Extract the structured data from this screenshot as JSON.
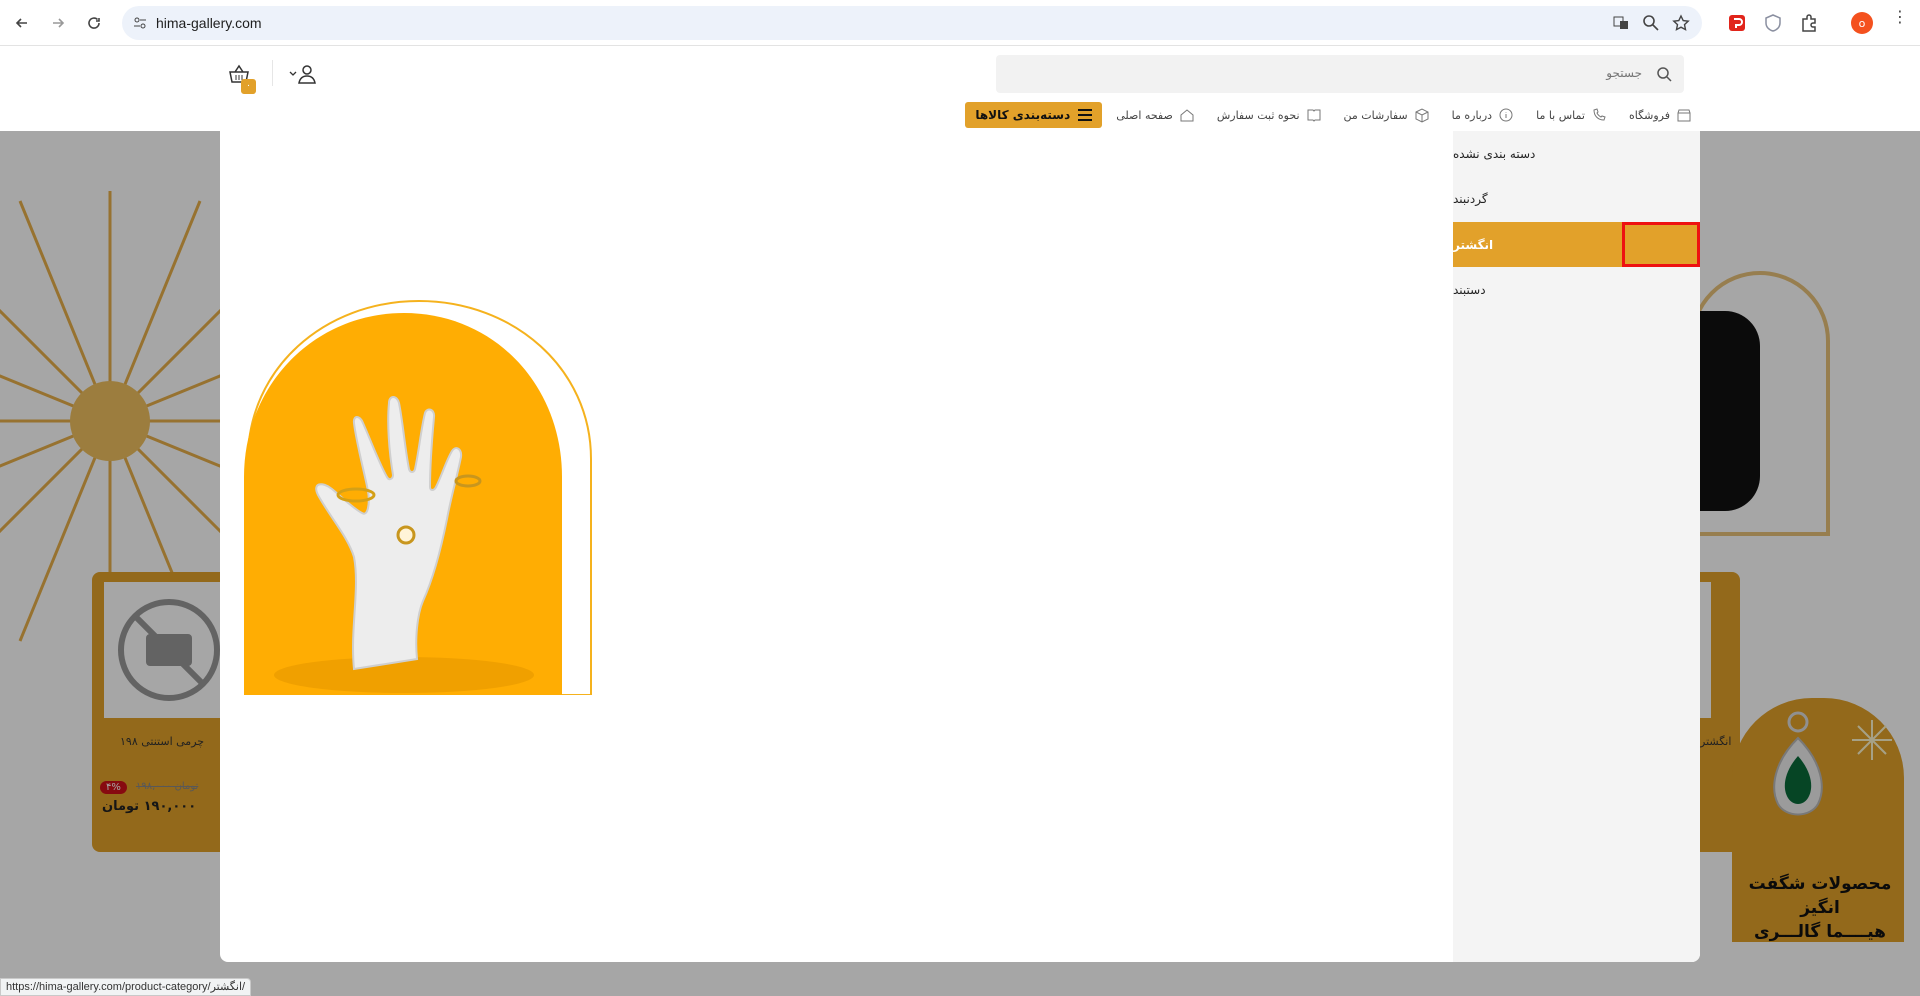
{
  "browser": {
    "url": "hima-gallery.com",
    "profile_initial": "o",
    "status_url": "https://hima-gallery.com/product-category/انگشتر/"
  },
  "header": {
    "search_placeholder": "جستجو",
    "cart_count": "۰",
    "categories_button": "دسته‌بندی کالاها",
    "nav": [
      {
        "label": "صفحه اصلی",
        "icon": "home-icon"
      },
      {
        "label": "نحوه ثبت سفارش",
        "icon": "book-icon"
      },
      {
        "label": "سفارشات من",
        "icon": "box-icon"
      },
      {
        "label": "درباره ما",
        "icon": "info-icon"
      },
      {
        "label": "تماس با ما",
        "icon": "phone-icon"
      },
      {
        "label": "فروشگاه",
        "icon": "store-icon"
      }
    ]
  },
  "mega_menu": {
    "categories": [
      {
        "label": "دسته بندی نشده",
        "active": false
      },
      {
        "label": "گردنبند",
        "active": false
      },
      {
        "label": "انگشتر",
        "active": true
      },
      {
        "label": "دستبند",
        "active": false
      }
    ]
  },
  "background": {
    "product_title": "چرمی استنتی ۱۹۸",
    "discount": "۴%",
    "old_price": "تومان ۱۹۸,۰۰۰",
    "price": "۱۹۰,۰۰۰ تومان",
    "right_product_label": "انگشتر",
    "promo_line1": "محصولات شگفت انگیز",
    "promo_line2": "هیــــما گالـــری"
  },
  "colors": {
    "accent": "#e2a12a",
    "highlight": "#e11111"
  }
}
